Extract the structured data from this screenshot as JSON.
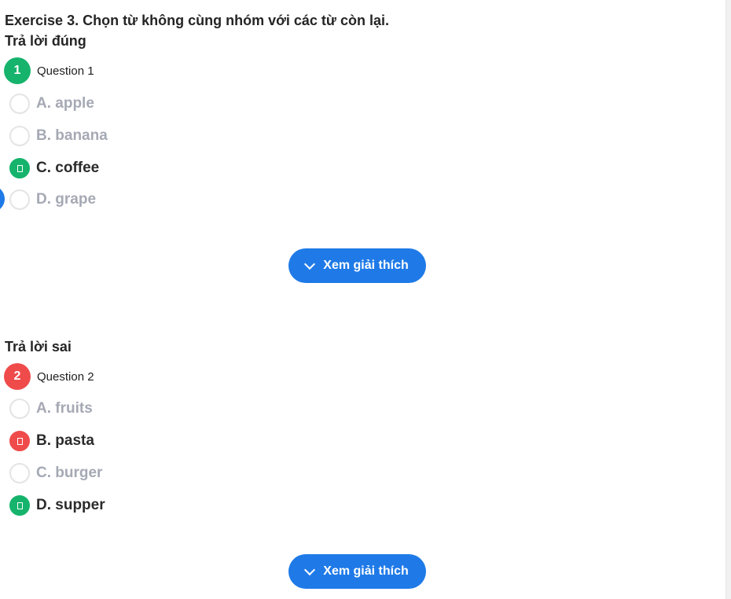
{
  "exercise": {
    "title": "Exercise 3. Chọn từ không cùng nhóm với các từ còn lại."
  },
  "sections": [
    {
      "title": "Trả lời đúng",
      "question": {
        "number": "1",
        "label": "Question 1"
      },
      "options": [
        {
          "label": "A. apple",
          "state": "unselected"
        },
        {
          "label": "B. banana",
          "state": "unselected"
        },
        {
          "label": "C. coffee",
          "state": "correct"
        },
        {
          "label": "D. grape",
          "state": "unselected"
        }
      ],
      "explain_button": "Xem giải thích"
    },
    {
      "title": "Trả lời sai",
      "question": {
        "number": "2",
        "label": "Question 2"
      },
      "options": [
        {
          "label": "A. fruits",
          "state": "unselected"
        },
        {
          "label": "B. pasta",
          "state": "wrong"
        },
        {
          "label": "C. burger",
          "state": "unselected"
        },
        {
          "label": "D. supper",
          "state": "correct"
        }
      ],
      "explain_button": "Xem giải thích"
    }
  ],
  "colors": {
    "correct": "#16b36c",
    "wrong": "#ef4b4b",
    "accent": "#1f7ae8",
    "muted_text": "#a5a9b4"
  }
}
